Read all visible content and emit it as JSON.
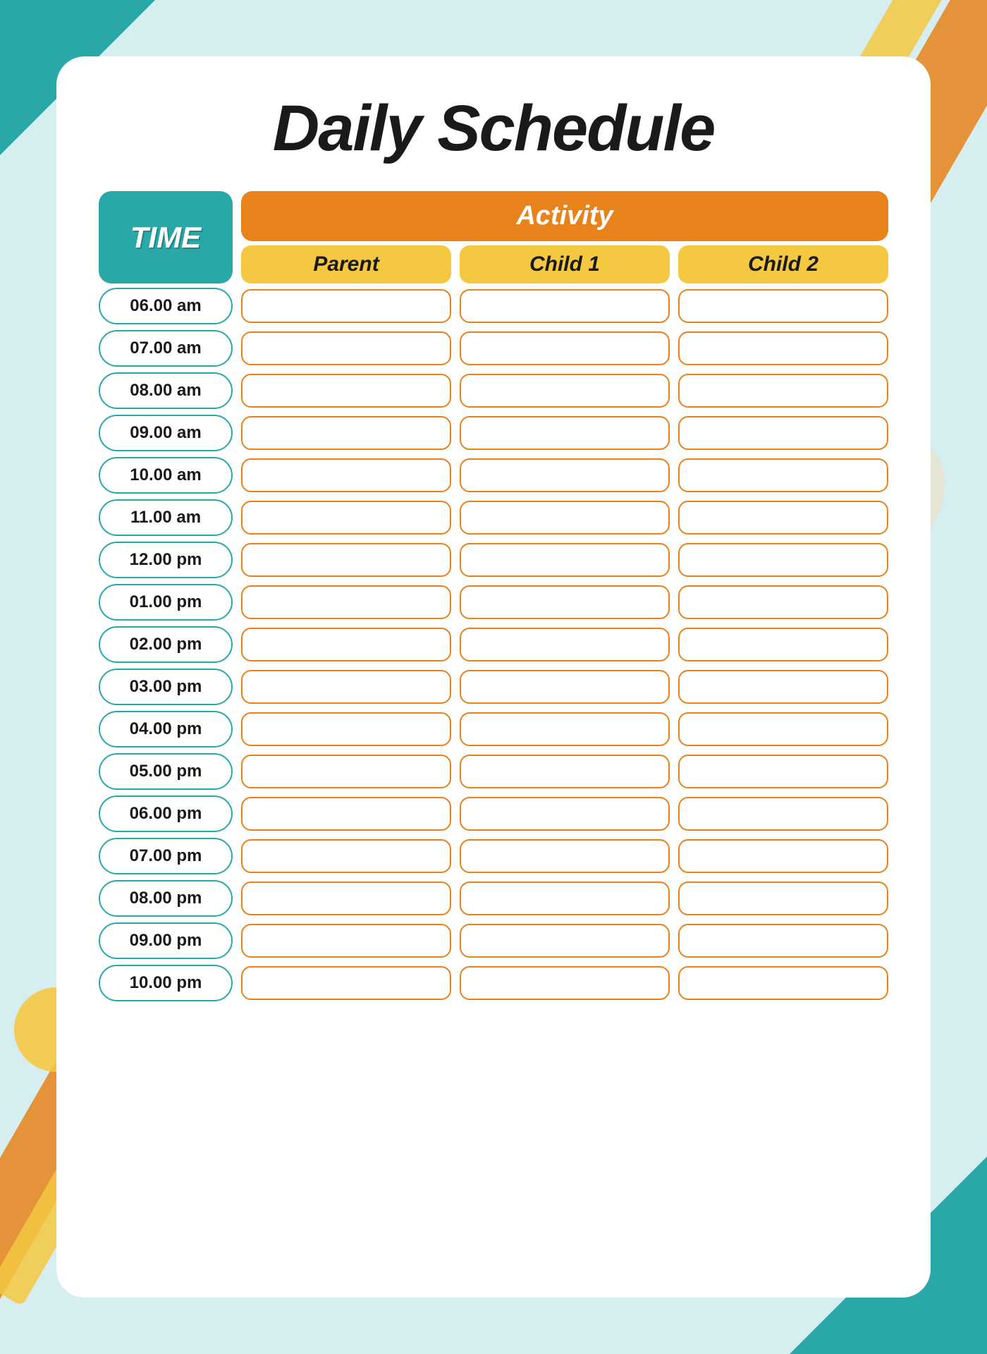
{
  "title": "Daily Schedule",
  "timeHeader": "TIME",
  "activityHeader": "Activity",
  "subHeaders": [
    "Parent",
    "Child 1",
    "Child 2"
  ],
  "timeSlots": [
    "06.00 am",
    "07.00 am",
    "08.00 am",
    "09.00 am",
    "10.00 am",
    "11.00 am",
    "12.00 pm",
    "01.00 pm",
    "02.00 pm",
    "03.00 pm",
    "04.00 pm",
    "05.00 pm",
    "06.00 pm",
    "07.00 pm",
    "08.00 pm",
    "09.00 pm",
    "10.00 pm"
  ],
  "colors": {
    "teal": "#2aa8a8",
    "orange": "#e8821a",
    "yellow": "#f5c842",
    "peach": "#f5d9b8",
    "background": "#d6eef0"
  }
}
